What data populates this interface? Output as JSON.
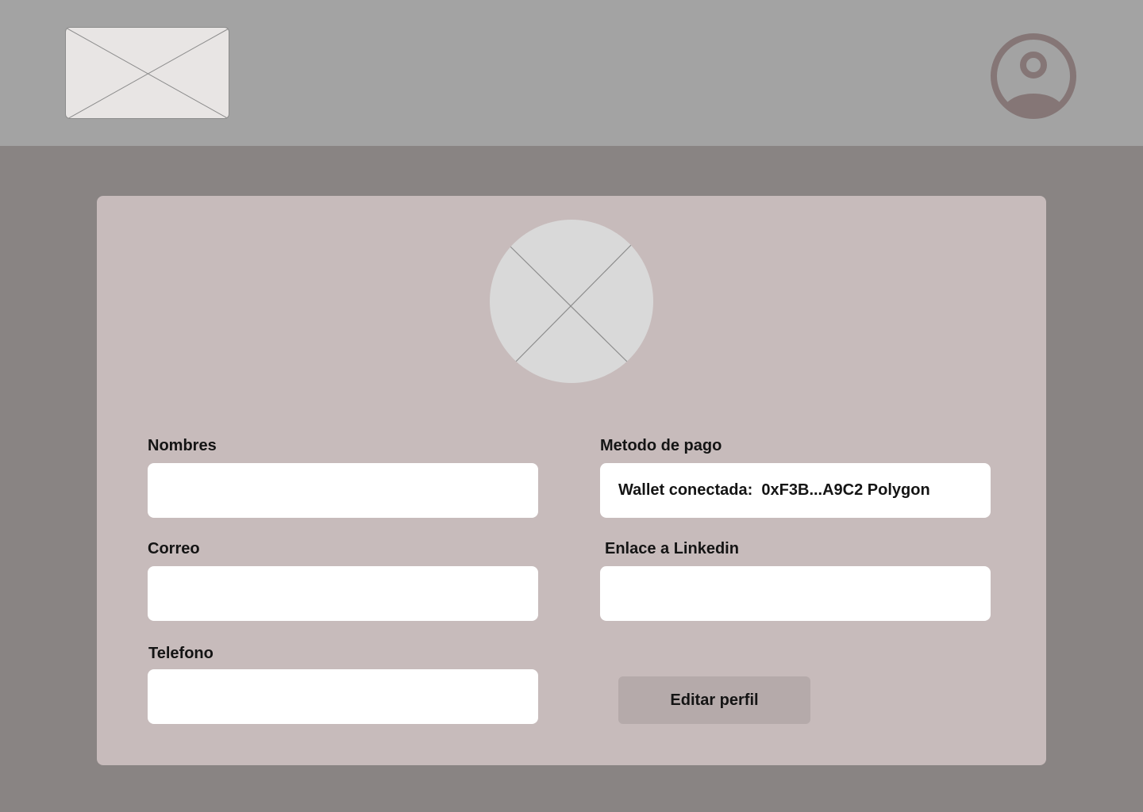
{
  "header": {
    "logo_icon": "image-placeholder-icon",
    "user_icon": "user-profile-icon"
  },
  "profile": {
    "avatar_icon": "image-placeholder-icon",
    "fields": {
      "nombres": {
        "label": "Nombres",
        "value": ""
      },
      "correo": {
        "label": "Correo",
        "value": ""
      },
      "telefono": {
        "label": "Telefono",
        "value": ""
      },
      "metodo_pago": {
        "label": "Metodo de pago",
        "value": "Wallet conectada:  0xF3B...A9C2 Polygon"
      },
      "linkedin": {
        "label": "Enlace a Linkedin",
        "value": ""
      }
    },
    "edit_button_label": "Editar perfil"
  },
  "colors": {
    "background": "#898483",
    "header": "#a3a3a3",
    "card": "#c7bbbb",
    "input": "#ffffff",
    "button": "#b5aaaa",
    "icon": "#857676"
  }
}
